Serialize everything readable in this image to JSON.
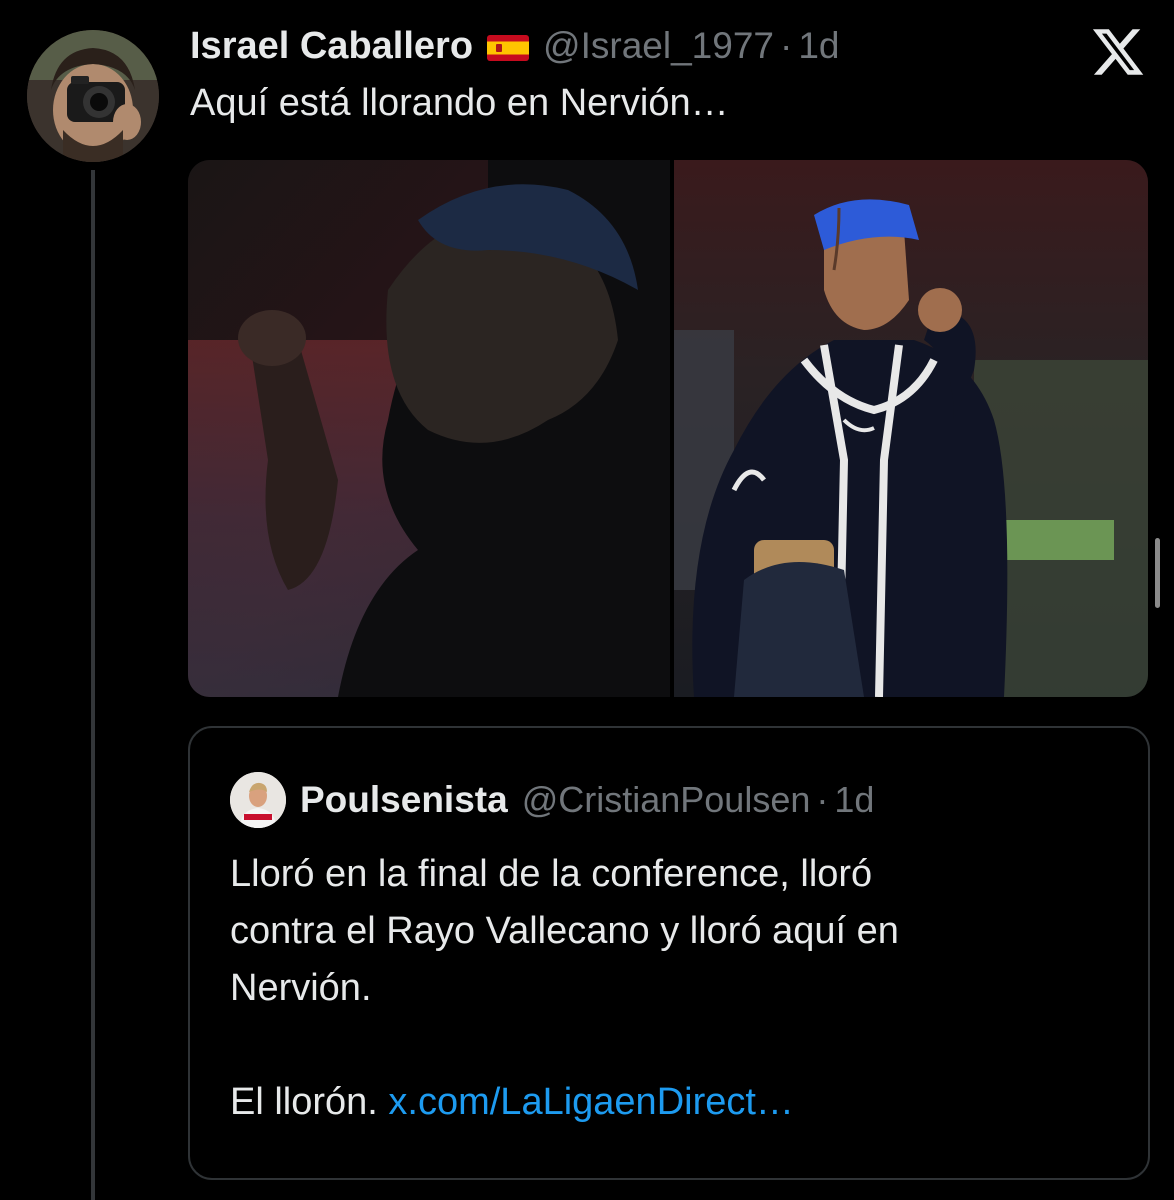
{
  "tweet": {
    "author_name": "Israel Caballero",
    "flag_icon": "spain-flag-icon",
    "handle": "@Israel_1977",
    "separator": "·",
    "time": "1d",
    "text": "Aquí está llorando en Nervión…"
  },
  "media": {
    "images": [
      {
        "icon": "photo-player-celebrating-dark"
      },
      {
        "icon": "photo-player-blue-cap-fist"
      }
    ]
  },
  "quote": {
    "author_name": "Poulsenista",
    "handle": "@CristianPoulsen",
    "separator": "·",
    "time": "1d",
    "lines": [
      "Lloró en la final de la conference, lloró",
      "contra el Rayo Vallecano y lloró aquí en",
      "Nervión."
    ],
    "last_line_prefix": "El llorón. ",
    "link_text": "x.com/LaLigaenDirect…"
  },
  "colors": {
    "background": "#000000",
    "text_primary": "#e7e9ea",
    "text_secondary": "#71767b",
    "link": "#1d9bf0",
    "border": "#2f3336"
  }
}
